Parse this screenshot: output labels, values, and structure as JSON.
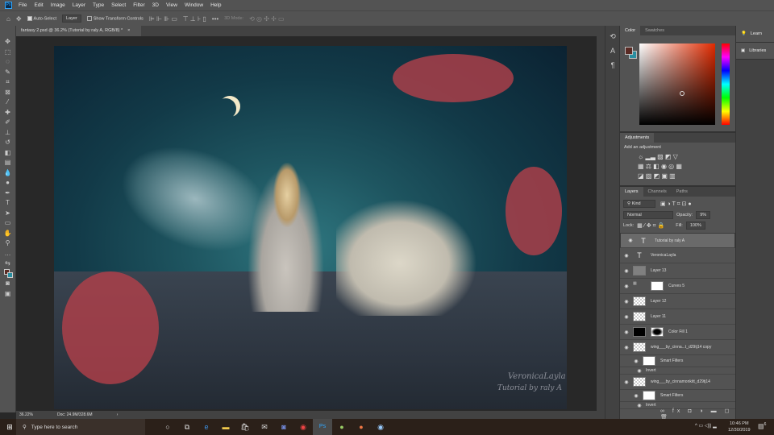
{
  "menu": [
    "File",
    "Edit",
    "Image",
    "Layer",
    "Type",
    "Select",
    "Filter",
    "3D",
    "View",
    "Window",
    "Help"
  ],
  "options": {
    "auto_select": "Auto-Select",
    "target": "Layer",
    "transform": "Show Transform Controls",
    "mode3d": "3D Mode:"
  },
  "tab": {
    "title": "fantasy 2.psd @ 36.2% (Tutorial by raly A, RGB/8) *",
    "close": "×"
  },
  "watermark": {
    "line1": "VeronicaLayla",
    "line2": "Tutorial by raly A"
  },
  "status": {
    "zoom": "36.22%",
    "doc": "Doc: 24.9M/328.6M",
    "arrow": "›"
  },
  "color_panel": {
    "tabs": [
      "Color",
      "Swatches"
    ],
    "foreground": "#5a2a24",
    "background": "#2a8ea0"
  },
  "adjustments": {
    "tab": "Adjustments",
    "hint": "Add an adjustment"
  },
  "learn": {
    "learn": "Learn",
    "libraries": "Libraries"
  },
  "layers_panel": {
    "tabs": [
      "Layers",
      "Channels",
      "Paths"
    ],
    "filter": "Kind",
    "blend": "Normal",
    "opacity_label": "Opacity:",
    "opacity": "9%",
    "lock_label": "Lock:",
    "fill_label": "Fill:",
    "fill": "100%",
    "layers": [
      {
        "name": "Tutorial by raly A",
        "type": "text",
        "selected": true
      },
      {
        "name": "VeronicaLayla",
        "type": "text"
      },
      {
        "name": "Layer 13",
        "type": "gray"
      },
      {
        "name": "Curves 5",
        "type": "adjust"
      },
      {
        "name": "Layer 12",
        "type": "pixel"
      },
      {
        "name": "Layer 11",
        "type": "pixel"
      },
      {
        "name": "Color Fill 1",
        "type": "fill"
      },
      {
        "name": "wing___by_cinna...t_d29tj14 copy",
        "type": "smart"
      },
      {
        "name": "Smart Filters",
        "type": "filter"
      },
      {
        "name": "Invert",
        "type": "sub"
      },
      {
        "name": "wing___by_cinnamonkitt_d29tj14",
        "type": "smart"
      },
      {
        "name": "Smart Filters",
        "type": "filter"
      },
      {
        "name": "Invert",
        "type": "sub"
      }
    ]
  },
  "taskbar": {
    "search": "Type here to search",
    "time": "10:46 PM",
    "date": "12/30/2019",
    "notif": "6"
  }
}
